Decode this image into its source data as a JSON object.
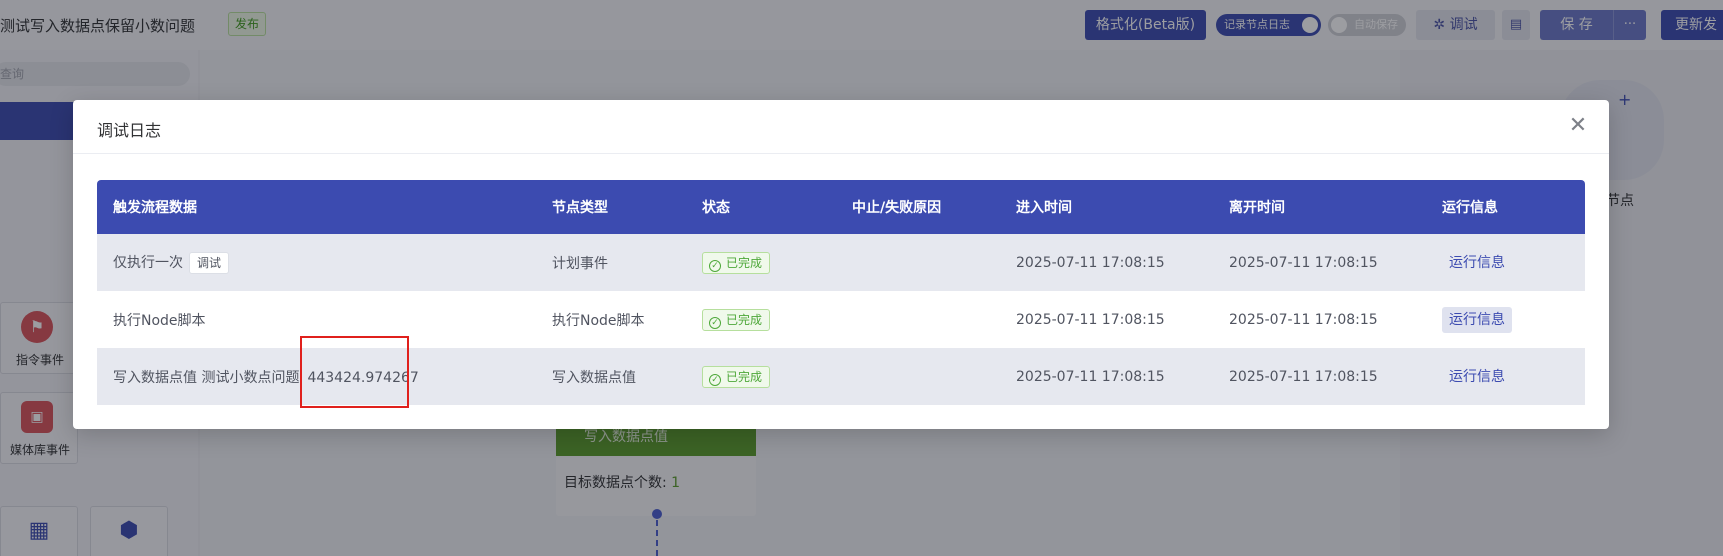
{
  "app": {
    "title": "测试写入数据点保留小数问题",
    "publish_tag": "发布",
    "toolbar": {
      "format_label": "格式化(Beta版)",
      "record_log_label": "记录节点日志",
      "auto_save_label": "自动保存",
      "debug_label": "调试",
      "save_label": "保 存",
      "more_label": "···",
      "update_label": "更新发"
    }
  },
  "left_panel": {
    "search_placeholder": "查询",
    "cards": [
      {
        "label": "指令事件",
        "icon": "flag-icon"
      },
      {
        "label": "媒体库事件",
        "icon": "media-icon"
      }
    ]
  },
  "canvas": {
    "node_title": "写入数据点值",
    "node_field_label": "目标数据点个数:",
    "node_field_value": "1",
    "right_node_label": "节点"
  },
  "modal": {
    "title": "调试日志",
    "close_icon": "close-icon",
    "columns": [
      "触发流程数据",
      "节点类型",
      "状态",
      "中止/失败原因",
      "进入时间",
      "离开时间",
      "运行信息"
    ],
    "rows": [
      {
        "trigger": "仅执行一次",
        "trigger_tag": "调试",
        "trigger_value": "",
        "node_type": "计划事件",
        "status": "已完成",
        "reason": "",
        "enter_time": "2025-07-11 17:08:15",
        "leave_time": "2025-07-11 17:08:15",
        "run_info": "运行信息"
      },
      {
        "trigger": "执行Node脚本",
        "trigger_tag": "",
        "trigger_value": "",
        "node_type": "执行Node脚本",
        "status": "已完成",
        "reason": "",
        "enter_time": "2025-07-11 17:08:15",
        "leave_time": "2025-07-11 17:08:15",
        "run_info": "运行信息"
      },
      {
        "trigger": "写入数据点值 测试小数点问题",
        "trigger_tag": "",
        "trigger_value": "443424.974267",
        "node_type": "写入数据点值",
        "status": "已完成",
        "reason": "",
        "enter_time": "2025-07-11 17:08:15",
        "leave_time": "2025-07-11 17:08:15",
        "run_info": "运行信息"
      }
    ]
  },
  "colors": {
    "primary": "#3c4bb0",
    "success": "#4ea83a",
    "highlight": "#e0201c"
  }
}
